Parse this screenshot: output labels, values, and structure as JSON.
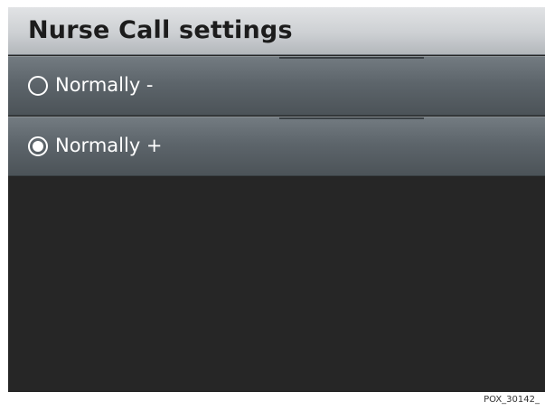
{
  "header": {
    "title": "Nurse Call settings"
  },
  "options": [
    {
      "label": "Normally -",
      "selected": false
    },
    {
      "label": "Normally +",
      "selected": true
    }
  ],
  "footer": {
    "figure_id": "POX_30142_"
  },
  "colors": {
    "background": "#262626",
    "header": "#cdd0d3",
    "option": "#5d656b",
    "text": "#ffffff"
  },
  "icons": {
    "radio_unselected": "radio-empty-icon",
    "radio_selected": "radio-checked-icon"
  }
}
